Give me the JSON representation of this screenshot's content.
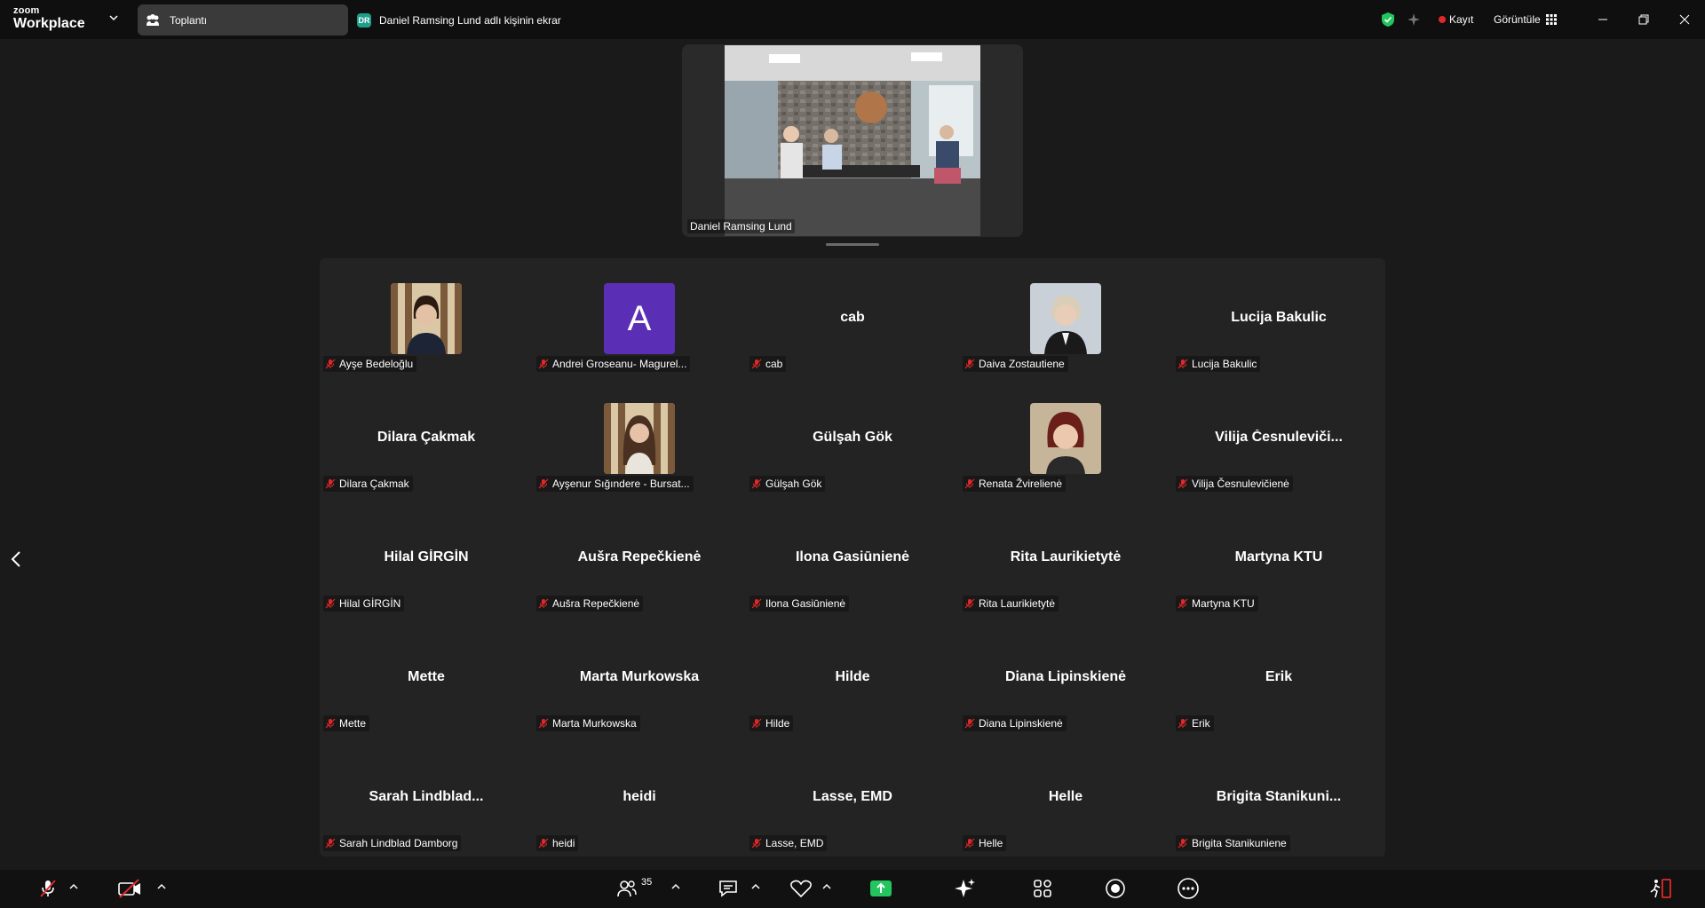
{
  "titlebar": {
    "logo_small": "zoom",
    "logo_big": "Workplace",
    "tab_meeting": "Toplantı",
    "tab_share_badge": "DR",
    "tab_share_label": "Daniel Ramsing Lund adlı kişinin ekrar",
    "record_label": "Kayıt",
    "view_label": "Görüntüle"
  },
  "shared_screen": {
    "presenter_name": "Daniel Ramsing Lund"
  },
  "participants": [
    {
      "big": "",
      "tag": "Ayşe Bedeloğlu",
      "avatar": "photo-woman-dark-hair"
    },
    {
      "big": "",
      "tag": "Andrei Groseanu- Magurel...",
      "avatar": "letter",
      "letter": "A"
    },
    {
      "big": "cab",
      "tag": "cab"
    },
    {
      "big": "",
      "tag": "Daiva Zostautiene",
      "avatar": "photo-woman-blonde"
    },
    {
      "big": "Lucija Bakulic",
      "tag": "Lucija Bakulic"
    },
    {
      "big": "Dilara Çakmak",
      "tag": "Dilara Çakmak"
    },
    {
      "big": "",
      "tag": "Ayşenur Sığındere - Bursat...",
      "avatar": "photo-woman-long-hair"
    },
    {
      "big": "Gülşah Gök",
      "tag": "Gülşah Gök"
    },
    {
      "big": "",
      "tag": "Renata Žvirelienė",
      "avatar": "photo-woman-red-hair"
    },
    {
      "big": "Vilija  Česnulevič​i...",
      "tag": "Vilija Česnulevičienė"
    },
    {
      "big": "Hilal GİRGİN",
      "tag": "Hilal GİRGİN"
    },
    {
      "big": "Aušra Repečkienė",
      "tag": "Aušra Repečkienė"
    },
    {
      "big": "Ilona Gasiūnienė",
      "tag": "Ilona Gasiūnienė"
    },
    {
      "big": "Rita Laurikietytė",
      "tag": "Rita Laurikietytė"
    },
    {
      "big": "Martyna KTU",
      "tag": "Martyna KTU"
    },
    {
      "big": "Mette",
      "tag": "Mette"
    },
    {
      "big": "Marta Murkowska",
      "tag": "Marta Murkowska"
    },
    {
      "big": "Hilde",
      "tag": "Hilde"
    },
    {
      "big": "Diana Lipinskienė",
      "tag": "Diana Lipinskienė"
    },
    {
      "big": "Erik",
      "tag": "Erik"
    },
    {
      "big": "Sarah  Lindblad...",
      "tag": "Sarah Lindblad Damborg"
    },
    {
      "big": "heidi",
      "tag": "heidi"
    },
    {
      "big": "Lasse, EMD",
      "tag": "Lasse, EMD"
    },
    {
      "big": "Helle",
      "tag": "Helle"
    },
    {
      "big": "Brigita  Stanikuni...",
      "tag": "Brigita Stanikuniene"
    }
  ],
  "toolbar": {
    "participants_count": "35"
  },
  "colors": {
    "background": "#1a1a1a",
    "gallery": "#232323",
    "muted_red": "#e02828",
    "share_green": "#23c55e",
    "avatar_purple": "#5b2fb5"
  }
}
